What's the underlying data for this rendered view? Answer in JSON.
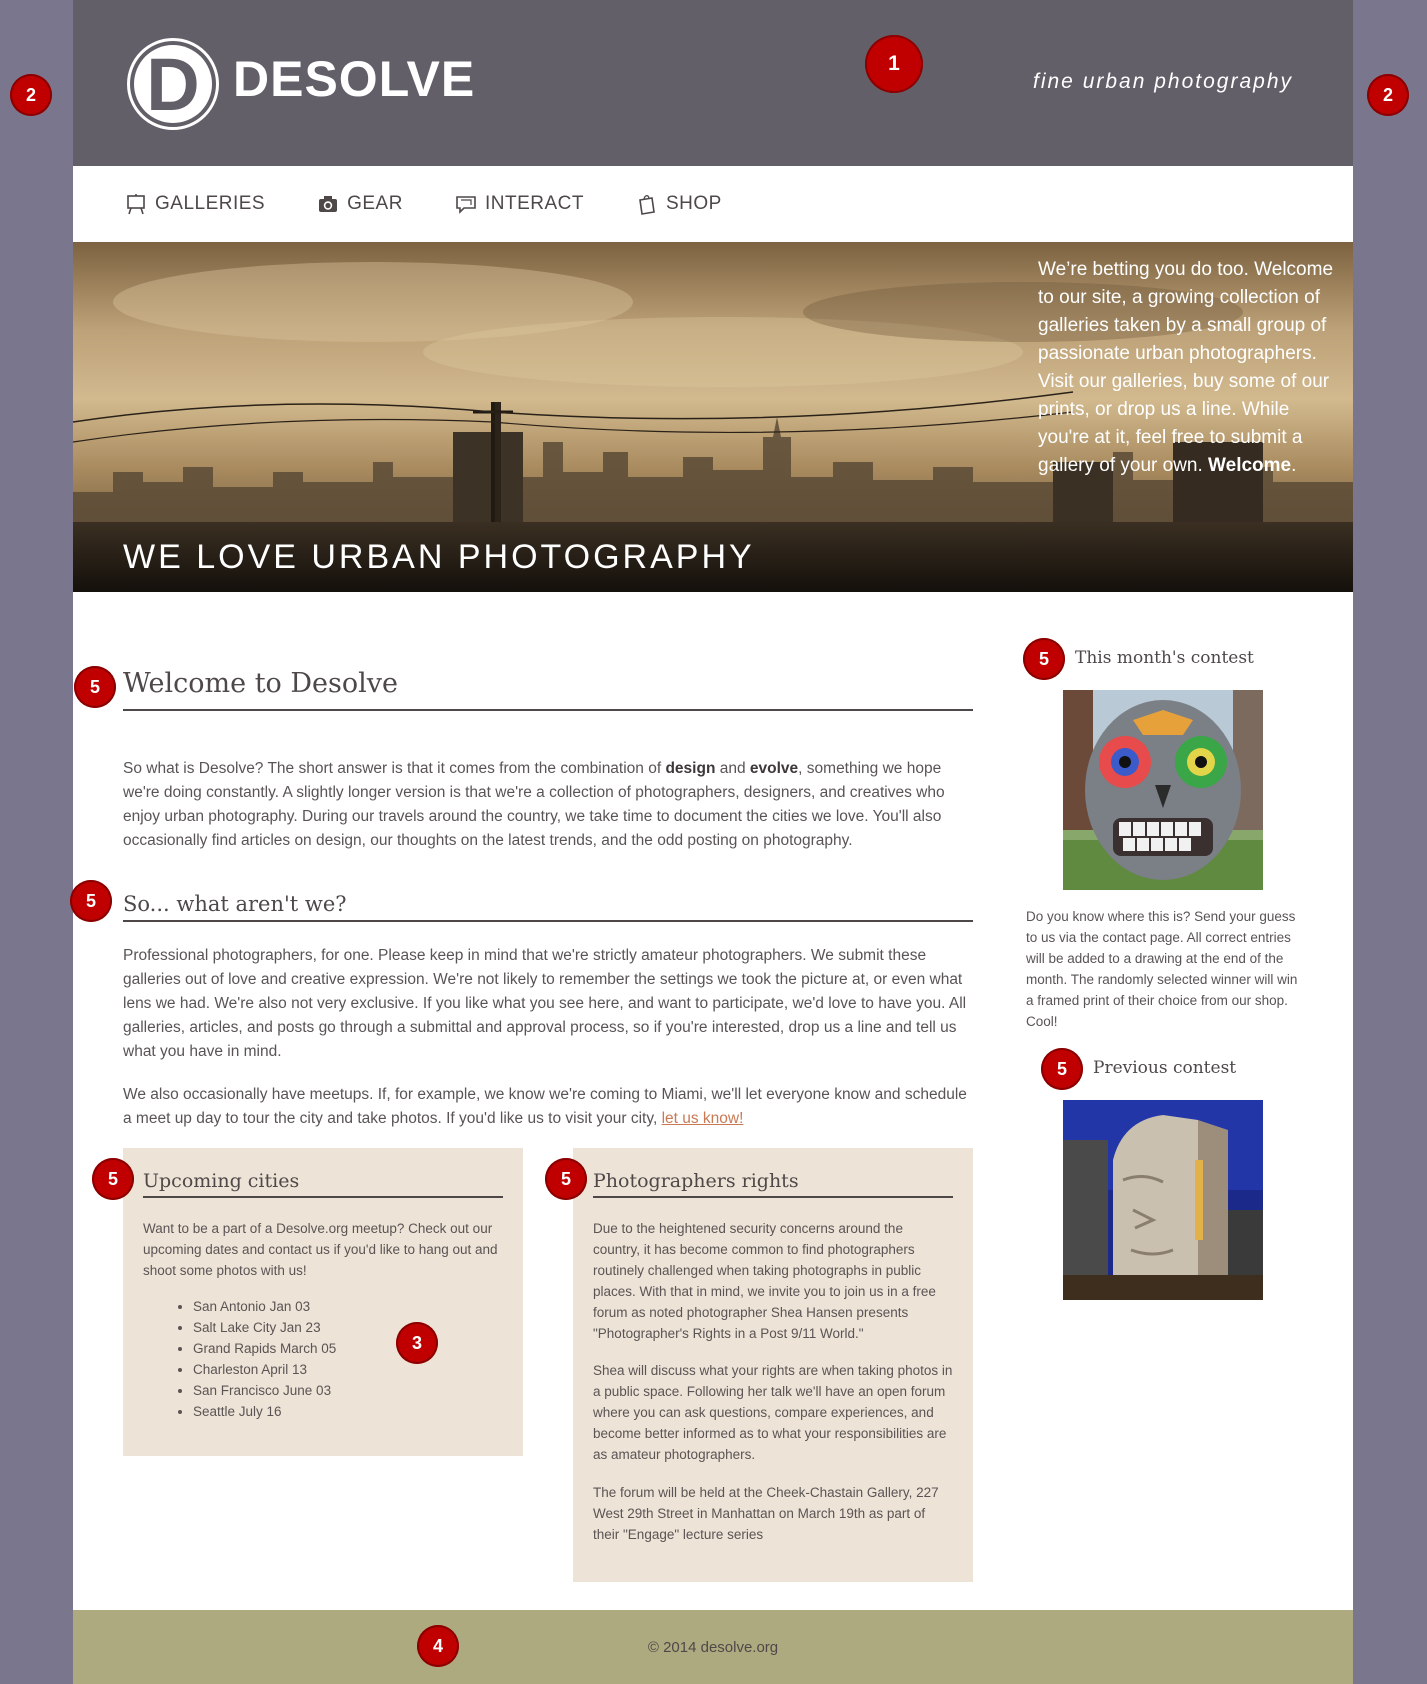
{
  "header": {
    "logo_letter": "D",
    "logo_text": "DESOLVE",
    "tagline": "fine urban photography"
  },
  "nav": {
    "items": [
      {
        "label": "GALLERIES",
        "icon": "easel-icon"
      },
      {
        "label": "GEAR",
        "icon": "camera-icon"
      },
      {
        "label": "INTERACT",
        "icon": "speech-bubble-icon"
      },
      {
        "label": "SHOP",
        "icon": "shopping-bag-icon"
      }
    ]
  },
  "hero": {
    "title": "WE LOVE URBAN PHOTOGRAPHY",
    "text_before": "We’re betting you do too. Welcome to our site, a growing collection of galleries taken by a small group of passionate urban photographers. Visit our galleries, buy some of our prints, or drop us a line. While you're at it, feel free to submit a gallery of your own. ",
    "text_bold": "Welcome",
    "text_after": "."
  },
  "main": {
    "title": "Welcome to Desolve",
    "intro_1": "So what is Desolve? The short answer is that it comes from the combination of ",
    "intro_bold_1": "design",
    "intro_2": " and ",
    "intro_bold_2": "evolve",
    "intro_3": ", something we hope we're doing constantly. A slightly longer version is that we're a collection of photographers, designers, and creatives who enjoy urban photography. During our travels around the country, we take time to document the cities we love. You'll also occasionally find articles on design, our thoughts on the latest trends, and the odd posting on photography.",
    "subtitle": "So... what aren't we?",
    "para_2": "Professional photographers, for one. Please keep in mind that we're strictly amateur photographers. We submit these galleries out of love and creative expression. We're not likely to remember the settings we took the picture at, or even what lens we had. We're also not very exclusive. If you like what you see here, and want to participate, we'd love to have you. All galleries, articles, and posts go through a submittal and approval process, so if you're interested, drop us a line and tell us what you have in mind.",
    "para_3": "We also occasionally have meetups. If, for example, we know we're coming to Miami, we'll let everyone know and schedule a meet up day to tour the city and take photos. If you'd like us to visit your city, ",
    "para_3_link": "let us know!"
  },
  "upcoming": {
    "title": "Upcoming cities",
    "text": "Want to be a part of a Desolve.org meetup? Check out our upcoming dates and contact us if you'd like to hang out and shoot some photos with us!",
    "cities": [
      "San Antonio Jan 03",
      "Salt Lake City Jan 23",
      "Grand Rapids March 05",
      "Charleston April 13",
      "San Francisco June 03",
      "Seattle July 16"
    ]
  },
  "rights": {
    "title": "Photographers rights",
    "p1": "Due to the heightened security concerns around the country, it has become common to find photographers routinely challenged when taking photographs in public places. With that in mind, we invite you to join us in a free forum as noted photographer Shea Hansen presents \"Photographer's Rights in a Post 9/11 World.\"",
    "p2": "Shea will discuss what your rights are when taking photos in a public space. Following her talk we'll have an open forum where you can ask questions, compare experiences, and become better informed as to what your responsibilities are as amateur photographers.",
    "p3": "The forum will be held at the Cheek-Chastain Gallery, 227 West 29th Street in Manhattan on March 19th as part of their \"Engage\" lecture series"
  },
  "sidebar": {
    "contest_title": "This month's contest",
    "contest_text": "Do you know where this is? Send your guess to us via the contact page. All correct entries will be added to a drawing at the end of the month. The randomly selected winner will win a framed print of their choice from our shop. Cool!",
    "previous_title": "Previous contest"
  },
  "footer": {
    "text": "© 2014 desolve.org"
  },
  "markers": {
    "m1": "1",
    "m2a": "2",
    "m2b": "2",
    "m3": "3",
    "m4": "4",
    "m5a": "5",
    "m5b": "5",
    "m5c": "5",
    "m5d": "5",
    "m5e": "5",
    "m5f": "5"
  },
  "colors": {
    "page_bg": "#7a768e",
    "header_bg": "#625f69",
    "box_bg": "#ede3d7",
    "footer_bg": "#aeaa80",
    "marker": "#c00000",
    "link": "#c97a55"
  }
}
